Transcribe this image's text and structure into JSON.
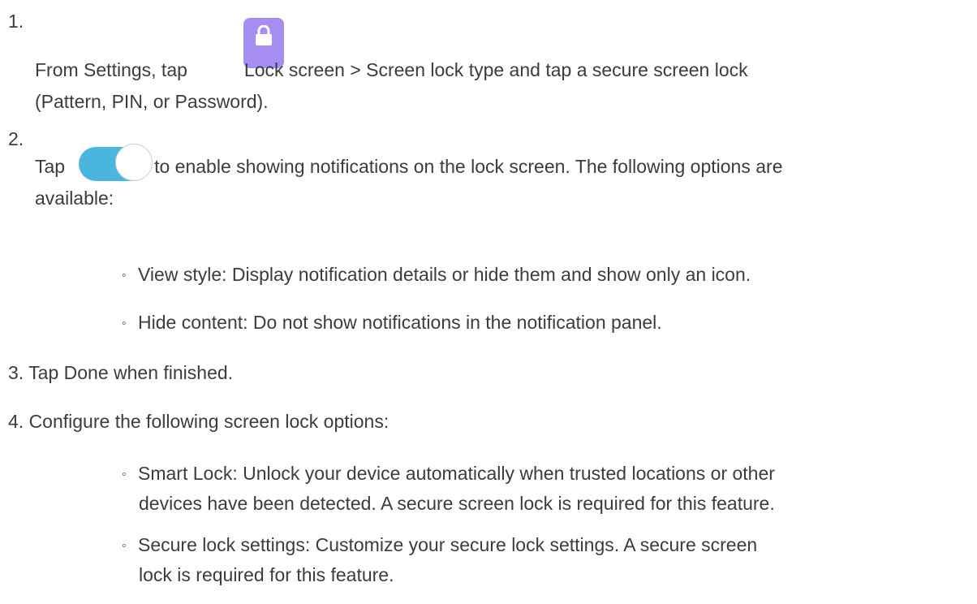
{
  "steps": [
    {
      "number": "1.",
      "line1_before": "From Settings, tap",
      "line1_after": "Lock screen > Screen lock type and tap a secure screen lock",
      "line2": "(Pattern, PIN, or Password)."
    },
    {
      "number": "2.",
      "line1_before": "Tap",
      "line1_after": "to enable showing notifications on the lock screen. The following options are",
      "line2": "available:",
      "bullets": [
        "View style: Display notification details or hide them and show only an icon.",
        "Hide content: Do not show notifications in the notification panel."
      ]
    },
    {
      "text": "3. Tap Done when finished."
    },
    {
      "text": "4. Configure the following screen lock options:",
      "bullets": [
        {
          "line1": "Smart Lock: Unlock your device automatically when trusted locations or other",
          "line2": "devices have been detected. A secure screen lock is required for this feature."
        },
        {
          "line1": "Secure lock settings: Customize your secure lock settings. A secure screen",
          "line2": "lock is required for this feature."
        }
      ]
    }
  ],
  "bullet_mark": "◦",
  "icons": {
    "lock": "lock-icon",
    "toggle": "toggle-on-icon"
  },
  "colors": {
    "lock_icon_bg": "#a58df2",
    "toggle_track": "#4ab6e0",
    "text": "#3c3c3c"
  }
}
